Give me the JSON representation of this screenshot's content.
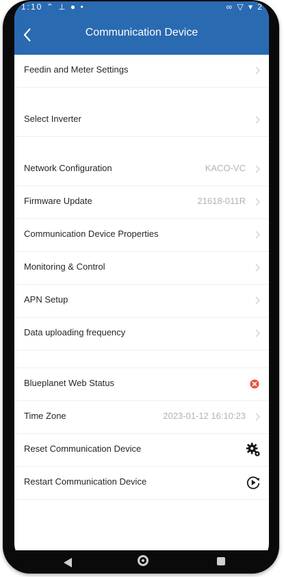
{
  "status_bar": {
    "left_text": "1:10 ⌃ ⊥ ● •",
    "right_text": "∞ ▽ ▾ 2"
  },
  "header": {
    "title": "Communication Device",
    "back_icon": "chevron-left-icon",
    "background": "#2a6ab1"
  },
  "rows": {
    "feedin": {
      "label": "Feedin and Meter Settings"
    },
    "select_inverter": {
      "label": "Select Inverter"
    },
    "network": {
      "label": "Network Configuration",
      "value": "KACO-VC"
    },
    "firmware": {
      "label": "Firmware Update",
      "value": "21618-011R"
    },
    "properties": {
      "label": "Communication Device Properties"
    },
    "monitoring": {
      "label": "Monitoring & Control"
    },
    "apn": {
      "label": "APN Setup"
    },
    "upload_freq": {
      "label": "Data uploading frequency"
    },
    "web_status": {
      "label": "Blueplanet Web Status",
      "icon": "error-icon",
      "icon_color": "#e8504a"
    },
    "timezone": {
      "label": "Time Zone",
      "value": "2023-01-12 16:10:23"
    },
    "reset": {
      "label": "Reset Communication Device",
      "icon": "gear-icon"
    },
    "restart": {
      "label": "Restart Communication Device",
      "icon": "restart-icon"
    }
  },
  "nav_bar": {
    "back_icon": "nav-back-icon",
    "home_icon": "nav-home-icon",
    "recent_icon": "nav-recent-icon"
  }
}
